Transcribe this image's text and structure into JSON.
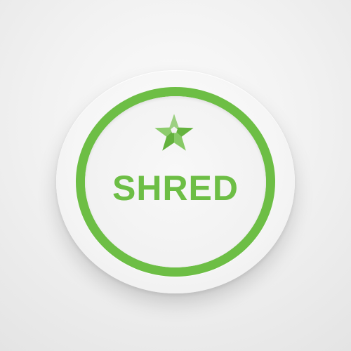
{
  "button": {
    "label": "SHRED",
    "icon": "star-icon",
    "accent_color": "#6dbe45"
  }
}
